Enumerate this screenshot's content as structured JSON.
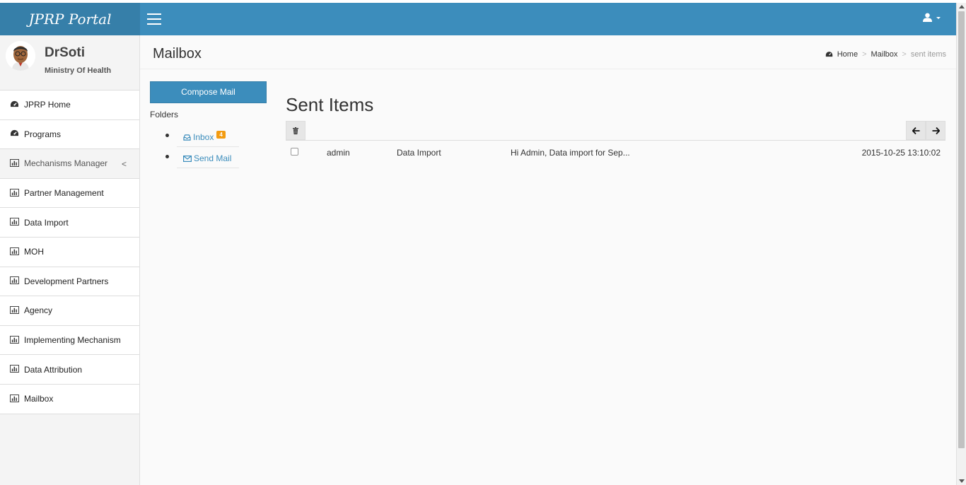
{
  "header": {
    "logo": "JPRP Portal"
  },
  "user": {
    "name": "DrSoti",
    "org": "Ministry Of Health"
  },
  "sidebar": {
    "items": [
      {
        "label": "JPRP Home",
        "icon": "dashboard-icon"
      },
      {
        "label": "Programs",
        "icon": "dashboard-icon"
      },
      {
        "label": "Mechanisms Manager",
        "icon": "bar-chart-icon"
      },
      {
        "label": "Partner Management",
        "icon": "bar-chart-icon"
      },
      {
        "label": "Data Import",
        "icon": "bar-chart-icon"
      },
      {
        "label": "MOH",
        "icon": "bar-chart-icon"
      },
      {
        "label": "Development Partners",
        "icon": "bar-chart-icon"
      },
      {
        "label": "Agency",
        "icon": "bar-chart-icon"
      },
      {
        "label": "Implementing Mechanism",
        "icon": "bar-chart-icon"
      },
      {
        "label": "Data Attribution",
        "icon": "bar-chart-icon"
      },
      {
        "label": "Mailbox",
        "icon": "bar-chart-icon"
      }
    ],
    "chevron": "<"
  },
  "content": {
    "title": "Mailbox",
    "breadcrumb": {
      "home": "Home",
      "mailbox": "Mailbox",
      "current": "sent items",
      "sep": ">"
    }
  },
  "mailbox": {
    "compose_label": "Compose Mail",
    "folders_label": "Folders",
    "folders": [
      {
        "label": "Inbox",
        "badge": "4",
        "icon": "inbox-icon"
      },
      {
        "label": "Send Mail",
        "icon": "envelope-icon"
      }
    ],
    "box_title": "Sent Items",
    "nav_prev": "🡐",
    "nav_next": "🡒",
    "messages": [
      {
        "name": "admin",
        "subject": "Data Import",
        "preview": "Hi Admin, Data import for Sep...",
        "date": "2015-10-25 13:10:02"
      }
    ]
  },
  "colors": {
    "brand": "#3c8dbc",
    "brand_dark": "#367fa9",
    "badge": "#f39c12"
  }
}
